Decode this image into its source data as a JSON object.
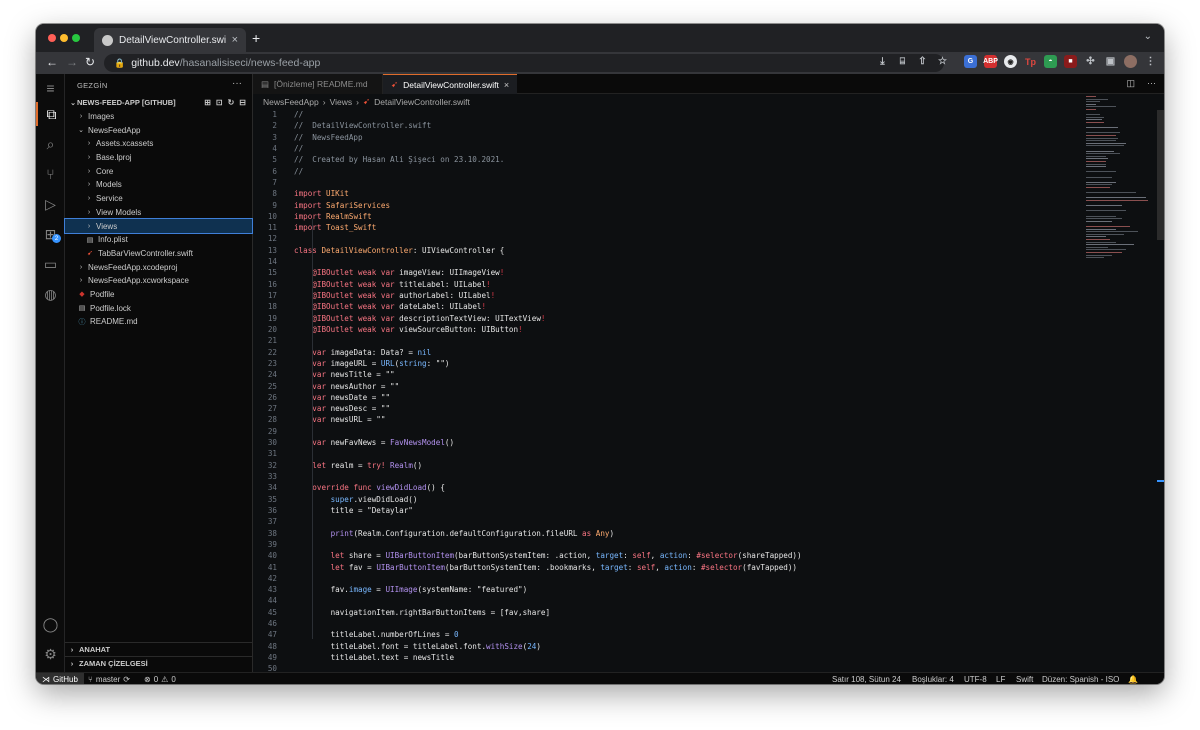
{
  "browser": {
    "tab_title": "DetailViewController.swift — n",
    "url_host": "github.dev",
    "url_path": "/hasanalisiseci/news-feed-app"
  },
  "explorer": {
    "title": "GEZGİN",
    "items": [
      {
        "label": "NEWS-FEED-APP [GITHUB]",
        "depth": 0,
        "type": "root",
        "chevron": "down"
      },
      {
        "label": "Images",
        "depth": 1,
        "type": "folder",
        "chevron": "right"
      },
      {
        "label": "NewsFeedApp",
        "depth": 1,
        "type": "folder",
        "chevron": "down"
      },
      {
        "label": "Assets.xcassets",
        "depth": 2,
        "type": "folder",
        "chevron": "right"
      },
      {
        "label": "Base.lproj",
        "depth": 2,
        "type": "folder",
        "chevron": "right"
      },
      {
        "label": "Core",
        "depth": 2,
        "type": "folder",
        "chevron": "right"
      },
      {
        "label": "Models",
        "depth": 2,
        "type": "folder",
        "chevron": "right"
      },
      {
        "label": "Service",
        "depth": 2,
        "type": "folder",
        "chevron": "right"
      },
      {
        "label": "View Models",
        "depth": 2,
        "type": "folder",
        "chevron": "right"
      },
      {
        "label": "Views",
        "depth": 2,
        "type": "folder",
        "chevron": "right",
        "selected": true
      },
      {
        "label": "Info.plist",
        "depth": 2,
        "type": "plist"
      },
      {
        "label": "TabBarViewController.swift",
        "depth": 2,
        "type": "swift"
      },
      {
        "label": "NewsFeedApp.xcodeproj",
        "depth": 1,
        "type": "folder",
        "chevron": "right"
      },
      {
        "label": "NewsFeedApp.xcworkspace",
        "depth": 1,
        "type": "folder",
        "chevron": "right"
      },
      {
        "label": "Podfile",
        "depth": 1,
        "type": "ruby"
      },
      {
        "label": "Podfile.lock",
        "depth": 1,
        "type": "lock"
      },
      {
        "label": "README.md",
        "depth": 1,
        "type": "md"
      }
    ],
    "outline_label": "ANAHAT",
    "timeline_label": "ZAMAN ÇİZELGESİ"
  },
  "editor": {
    "tabs": [
      {
        "label": "[Önizleme] README.md",
        "active": false
      },
      {
        "label": "DetailViewController.swift",
        "active": true
      }
    ],
    "breadcrumb": [
      "NewsFeedApp",
      "Views",
      "DetailViewController.swift"
    ],
    "start_line": 1
  },
  "code_lines": [
    [
      [
        "c-com",
        "//"
      ]
    ],
    [
      [
        "c-com",
        "//  DetailViewController.swift"
      ]
    ],
    [
      [
        "c-com",
        "//  NewsFeedApp"
      ]
    ],
    [
      [
        "c-com",
        "//"
      ]
    ],
    [
      [
        "c-com",
        "//  Created by Hasan Ali Şişeci on 23.10.2021."
      ]
    ],
    [
      [
        "c-com",
        "//"
      ]
    ],
    [],
    [
      [
        "c-kw",
        "import "
      ],
      [
        "c-type",
        "UIKit"
      ]
    ],
    [
      [
        "c-kw",
        "import "
      ],
      [
        "c-type",
        "SafariServices"
      ]
    ],
    [
      [
        "c-kw",
        "import "
      ],
      [
        "c-type",
        "RealmSwift"
      ]
    ],
    [
      [
        "c-kw",
        "import "
      ],
      [
        "c-type",
        "Toast_Swift"
      ]
    ],
    [],
    [
      [
        "c-kw",
        "class "
      ],
      [
        "c-type",
        "DetailViewController"
      ],
      [
        "",
        "："
      ],
      [
        "",
        ""
      ]
    ],
    [],
    [
      [
        "",
        "    "
      ],
      [
        "c-kw",
        "@IBOutlet weak var "
      ],
      [
        "",
        "imageView: UIImageView"
      ],
      [
        "c-err",
        "!"
      ]
    ],
    [
      [
        "",
        "    "
      ],
      [
        "c-kw",
        "@IBOutlet weak var "
      ],
      [
        "",
        "titleLabel: UILabel"
      ],
      [
        "c-err",
        "!"
      ]
    ],
    [
      [
        "",
        "    "
      ],
      [
        "c-kw",
        "@IBOutlet weak var "
      ],
      [
        "",
        "authorLabel: UILabel"
      ],
      [
        "c-err",
        "!"
      ]
    ],
    [
      [
        "",
        "    "
      ],
      [
        "c-kw",
        "@IBOutlet weak var "
      ],
      [
        "",
        "dateLabel: UILabel"
      ],
      [
        "c-err",
        "!"
      ]
    ],
    [
      [
        "",
        "    "
      ],
      [
        "c-kw",
        "@IBOutlet weak var "
      ],
      [
        "",
        "descriptionTextView: UITextView"
      ],
      [
        "c-err",
        "!"
      ]
    ],
    [
      [
        "",
        "    "
      ],
      [
        "c-kw",
        "@IBOutlet weak var "
      ],
      [
        "",
        "viewSourceButton: UIButton"
      ],
      [
        "c-err",
        "!"
      ]
    ],
    [],
    [
      [
        "",
        "    "
      ],
      [
        "c-kw",
        "var "
      ],
      [
        "",
        "imageData: Data? = "
      ],
      [
        "c-prop",
        "nil"
      ]
    ],
    [
      [
        "",
        "    "
      ],
      [
        "c-kw",
        "var "
      ],
      [
        "",
        "imageURL = "
      ],
      [
        "c-prop",
        "URL"
      ],
      [
        "",
        "("
      ],
      [
        "c-prop",
        "string"
      ],
      [
        "",
        ": \"\")"
      ]
    ],
    [
      [
        "",
        "    "
      ],
      [
        "c-kw",
        "var "
      ],
      [
        "",
        "newsTitle = \"\""
      ]
    ],
    [
      [
        "",
        "    "
      ],
      [
        "c-kw",
        "var "
      ],
      [
        "",
        "newsAuthor = \"\""
      ]
    ],
    [
      [
        "",
        "    "
      ],
      [
        "c-kw",
        "var "
      ],
      [
        "",
        "newsDate = \"\""
      ]
    ],
    [
      [
        "",
        "    "
      ],
      [
        "c-kw",
        "var "
      ],
      [
        "",
        "newsDesc = \"\""
      ]
    ],
    [
      [
        "",
        "    "
      ],
      [
        "c-kw",
        "var "
      ],
      [
        "",
        "newsURL = \"\""
      ]
    ],
    [],
    [
      [
        "",
        "    "
      ],
      [
        "c-kw",
        "var "
      ],
      [
        "",
        "newFavNews = "
      ],
      [
        "c-fn",
        "FavNewsModel"
      ],
      [
        "",
        "()"
      ]
    ],
    [],
    [
      [
        "",
        "    "
      ],
      [
        "c-kw",
        "let "
      ],
      [
        "",
        "realm = "
      ],
      [
        "c-kw",
        "try! "
      ],
      [
        "c-fn",
        "Realm"
      ],
      [
        "",
        "()"
      ]
    ],
    [],
    [
      [
        "",
        "    "
      ],
      [
        "c-kw",
        "override func "
      ],
      [
        "c-fn",
        "viewDidLoad"
      ],
      [
        "",
        "() {"
      ]
    ],
    [
      [
        "",
        "        "
      ],
      [
        "c-prop",
        "super"
      ],
      [
        "",
        ".viewDidLoad()"
      ]
    ],
    [
      [
        "",
        "        "
      ],
      [
        "",
        "title = \"Detaylar\""
      ]
    ],
    [],
    [
      [
        "",
        "        "
      ],
      [
        "c-fn",
        "print"
      ],
      [
        "",
        "(Realm.Configuration.defaultConfiguration.fileURL "
      ],
      [
        "c-kw",
        "as "
      ],
      [
        "c-type",
        "Any"
      ],
      [
        "",
        ")"
      ]
    ],
    [],
    [
      [
        "",
        "        "
      ],
      [
        "c-kw",
        "let "
      ],
      [
        "",
        "share = "
      ],
      [
        "c-fn",
        "UIBarButtonItem"
      ],
      [
        "",
        "(barButtonSystemItem: .action, "
      ],
      [
        "c-prop",
        "target"
      ],
      [
        "",
        ": "
      ],
      [
        "c-kw",
        "self"
      ],
      [
        "",
        ", "
      ],
      [
        "c-prop",
        "action"
      ],
      [
        "",
        ": "
      ],
      [
        "c-kw",
        "#selector"
      ],
      [
        "",
        "(shareTapped))"
      ]
    ],
    [
      [
        "",
        "        "
      ],
      [
        "c-kw",
        "let "
      ],
      [
        "",
        "fav = "
      ],
      [
        "c-fn",
        "UIBarButtonItem"
      ],
      [
        "",
        "(barButtonSystemItem: .bookmarks, "
      ],
      [
        "c-prop",
        "target"
      ],
      [
        "",
        ": "
      ],
      [
        "c-kw",
        "self"
      ],
      [
        "",
        ", "
      ],
      [
        "c-prop",
        "action"
      ],
      [
        "",
        ": "
      ],
      [
        "c-kw",
        "#selector"
      ],
      [
        "",
        "(favTapped))"
      ]
    ],
    [],
    [
      [
        "",
        "        "
      ],
      [
        "",
        "fav."
      ],
      [
        "c-prop",
        "image"
      ],
      [
        "",
        " = "
      ],
      [
        "c-fn",
        "UIImage"
      ],
      [
        "",
        "(systemName: \"featured\")"
      ]
    ],
    [],
    [
      [
        "",
        "        "
      ],
      [
        "",
        "navigationItem.rightBarButtonItems = [fav,share]"
      ]
    ],
    [],
    [
      [
        "",
        "        "
      ],
      [
        "",
        "titleLabel.numberOfLines = "
      ],
      [
        "c-prop",
        "0"
      ]
    ],
    [
      [
        "",
        "        "
      ],
      [
        "",
        "titleLabel.font = titleLabel.font."
      ],
      [
        "c-fn",
        "withSize"
      ],
      [
        "",
        "("
      ],
      [
        "c-prop",
        "24"
      ],
      [
        "",
        ")"
      ]
    ],
    [
      [
        "",
        "        "
      ],
      [
        "",
        "titleLabel.text = newsTitle"
      ]
    ],
    []
  ],
  "status": {
    "remote": "GitHub",
    "branch": "master",
    "problems": "0",
    "warnings": "0",
    "cursor": "Satır 108, Sütun 24",
    "indent": "Boşluklar: 4",
    "encoding": "UTF-8",
    "eol": "LF",
    "language": "Swift",
    "layout": "Düzen: Spanish - ISO"
  }
}
